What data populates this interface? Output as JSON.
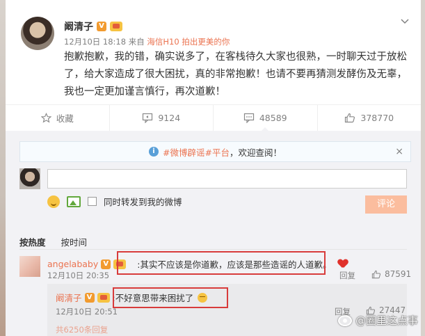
{
  "post": {
    "author": "阚清子",
    "time": "12月10日 18:18",
    "source_prefix": "来自",
    "source": "海信H10 拍出更美的你",
    "text": "抱歉抱歉，我的错，确实说多了，在客栈待久大家也很熟，一时聊天过于放松了，给大家造成了很大困扰，真的非常抱歉！也请不要再猜测发酵伤及无辜，我也一定更加谨言慎行，再次道歉！"
  },
  "actions": {
    "favorite_label": "收藏",
    "repost_count": "9124",
    "comment_count": "48589",
    "like_count": "378770"
  },
  "notice": {
    "link_text": "#微博辟谣#平台",
    "rest_text": "，欢迎查阅！"
  },
  "composer": {
    "also_repost_label": "同时转发到我的微博",
    "submit_label": "评论"
  },
  "sort_tabs": [
    "按热度",
    "按时间"
  ],
  "comments": [
    {
      "user": "angelababy",
      "text": ":其实不应该是你道歉，应该是那些造谣的人道歉。",
      "time": "12月10日 20:35",
      "reply_label": "回复",
      "likes": "87591"
    }
  ],
  "reply": {
    "user": "阚清子",
    "text": ":不好意思带来困扰了",
    "time": "12月10日 20:51",
    "reply_label": "回复",
    "likes": "27447",
    "more_text": "共6250条回复"
  },
  "watermark": "@圈里这点事",
  "colors": {
    "accent": "#eb7350",
    "highlight_box": "#d83b3b",
    "badge": "#f29b2f"
  }
}
